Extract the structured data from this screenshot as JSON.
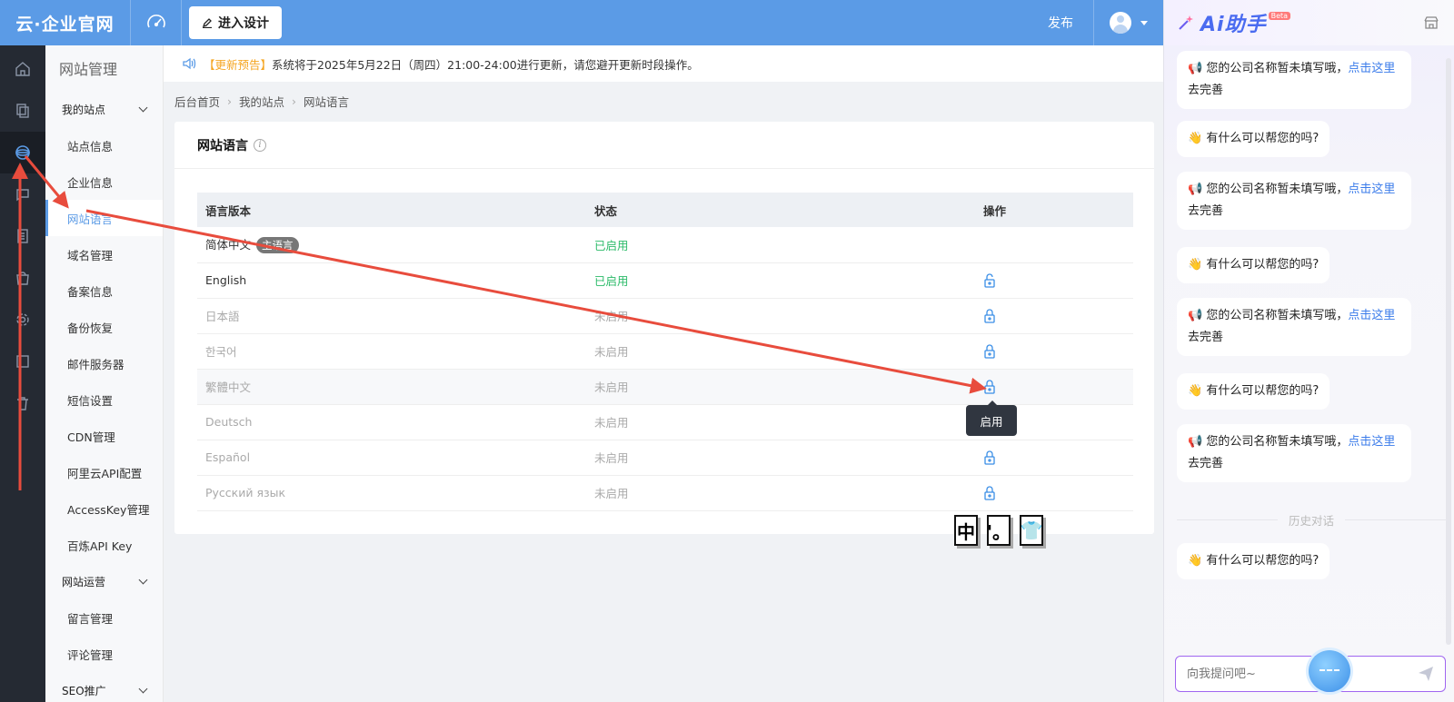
{
  "topbar": {
    "logo": "云·企业官网",
    "design_button": "进入设计",
    "publish": "发布"
  },
  "subnav": {
    "title": "网站管理",
    "groups": [
      {
        "label": "我的站点",
        "items": [
          "站点信息",
          "企业信息",
          "网站语言",
          "域名管理",
          "备案信息",
          "备份恢复",
          "邮件服务器",
          "短信设置",
          "CDN管理",
          "阿里云API配置",
          "AccessKey管理",
          "百炼API Key"
        ]
      },
      {
        "label": "网站运营",
        "items": [
          "留言管理",
          "评论管理"
        ]
      },
      {
        "label": "SEO推广",
        "items": []
      }
    ]
  },
  "notice": {
    "tag": "【更新预告】",
    "text": "系统将于2025年5月22日（周四）21:00-24:00进行更新，请您避开更新时段操作。"
  },
  "breadcrumb": [
    "后台首页",
    "我的站点",
    "网站语言"
  ],
  "card": {
    "title": "网站语言",
    "columns": [
      "语言版本",
      "状态",
      "操作"
    ],
    "main_badge": "主语言",
    "rows": [
      {
        "lang": "简体中文",
        "status": "已启用"
      },
      {
        "lang": "English",
        "status": "已启用"
      },
      {
        "lang": "日本語",
        "status": "未启用"
      },
      {
        "lang": "한국어",
        "status": "未启用"
      },
      {
        "lang": "繁體中文",
        "status": "未启用"
      },
      {
        "lang": "Deutsch",
        "status": "未启用"
      },
      {
        "lang": "Español",
        "status": "未启用"
      },
      {
        "lang": "Русский язык",
        "status": "未启用"
      }
    ],
    "tooltip": "启用"
  },
  "glyphs": [
    "中",
    "'。",
    "👕"
  ],
  "ai": {
    "title": "Ai助手",
    "beta": "Beta",
    "msg_company": "您的公司名称暂未填写哦，",
    "msg_link": "点击这里",
    "msg_after": "去完善",
    "msg_help": "有什么可以帮您的吗?",
    "history": "历史对话",
    "input_placeholder": "向我提问吧~"
  },
  "colors": {
    "brand": "#5b9be6",
    "success": "#2dbb6a",
    "arrow": "#e84c3d"
  }
}
